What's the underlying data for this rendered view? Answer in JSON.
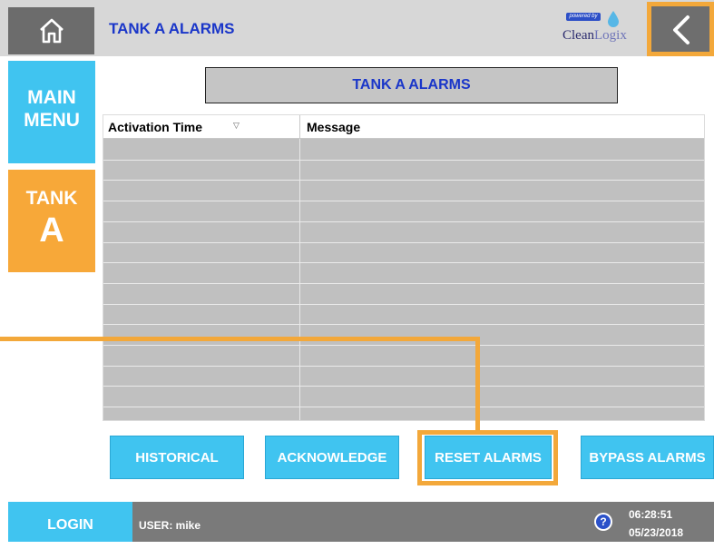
{
  "header": {
    "title": "TANK A ALARMS",
    "logo": {
      "powered_by": "powered by",
      "brand_part1": "Clean",
      "brand_part2": "Logix"
    },
    "home_icon": "home-icon",
    "back_icon": "chevron-left-icon"
  },
  "sidebar": {
    "main_menu_line1": "MAIN",
    "main_menu_line2": "MENU",
    "tank_line1": "TANK",
    "tank_line2": "A"
  },
  "main": {
    "alarm_title": "TANK A ALARMS",
    "table": {
      "columns": [
        "Activation Time",
        "Message"
      ],
      "sort_indicator": "▽",
      "rows": []
    }
  },
  "actions": {
    "historical": "HISTORICAL",
    "acknowledge": "ACKNOWLEDGE",
    "reset": "RESET ALARMS",
    "bypass": "BYPASS ALARMS"
  },
  "footer": {
    "login": "LOGIN",
    "user": "USER: mike",
    "help": "?",
    "time": "06:28:51",
    "date": "05/23/2018"
  },
  "colors": {
    "accent_blue": "#40c4f0",
    "accent_orange": "#f7a839",
    "title_blue": "#1a36c9",
    "callout": "#f3a83a"
  }
}
